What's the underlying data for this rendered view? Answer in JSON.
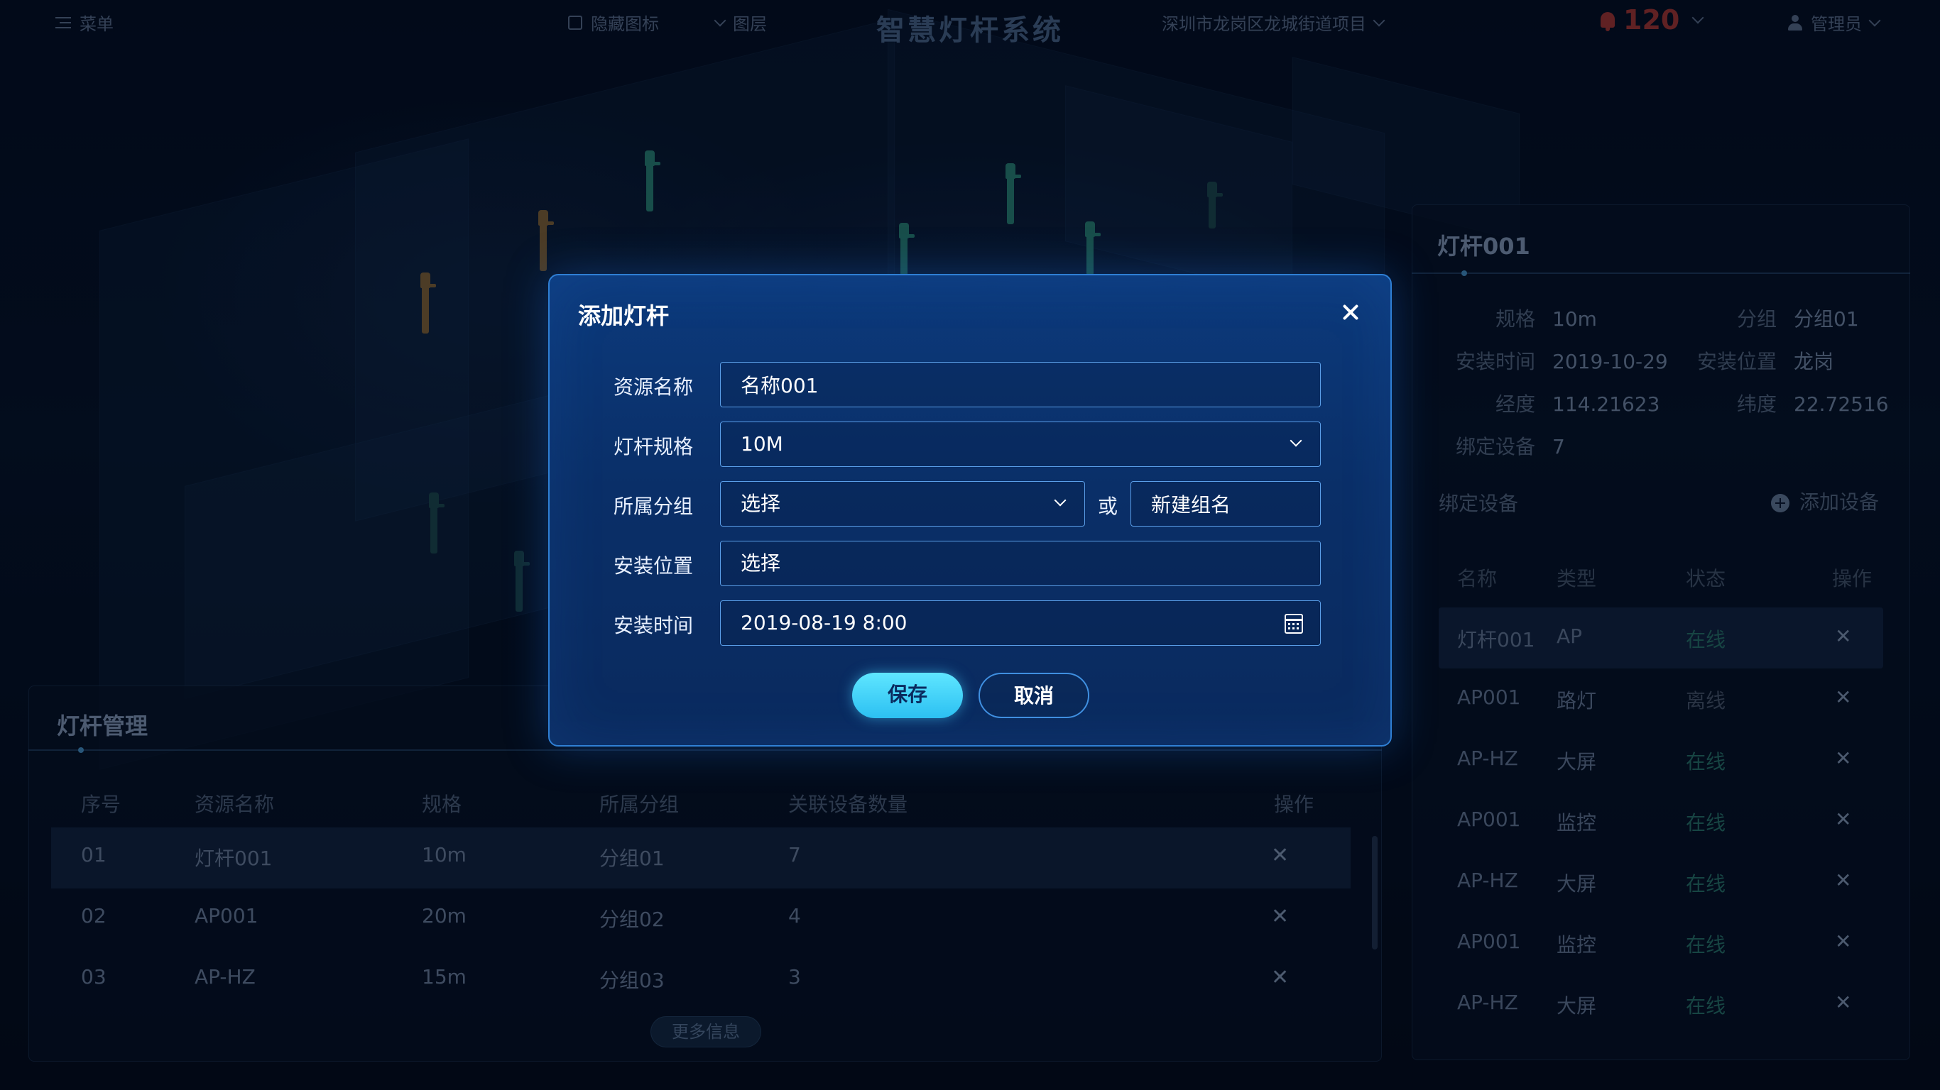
{
  "header": {
    "menu_label": "菜单",
    "hide_icons_label": "隐藏图标",
    "layers_label": "图层",
    "app_title": "智慧灯杆系统",
    "project": "深圳市龙岗区龙城街道项目",
    "alert_count": "120",
    "user": "管理员"
  },
  "left_panel": {
    "title": "灯杆管理",
    "columns": [
      "序号",
      "资源名称",
      "规格",
      "所属分组",
      "关联设备数量",
      "操作"
    ],
    "rows": [
      {
        "no": "01",
        "name": "灯杆001",
        "spec": "10m",
        "group": "分组01",
        "count": "7",
        "action": "✕"
      },
      {
        "no": "02",
        "name": "AP001",
        "spec": "20m",
        "group": "分组02",
        "count": "4",
        "action": "✕"
      },
      {
        "no": "03",
        "name": "AP-HZ",
        "spec": "15m",
        "group": "分组03",
        "count": "3",
        "action": "✕"
      }
    ],
    "more_label": "更多信息"
  },
  "right_panel": {
    "title": "灯杆001",
    "spec_label": "规格",
    "spec_value": "10m",
    "group_label": "分组",
    "group_value": "分组01",
    "install_time_label": "安装时间",
    "install_time_value": "2019-10-29",
    "install_loc_label": "安装位置",
    "install_loc_value": "龙岗",
    "lng_label": "经度",
    "lng_value": "114.21623",
    "lat_label": "纬度",
    "lat_value": "22.72516",
    "bound_label": "绑定设备",
    "bound_value": "7",
    "bound_section": "绑定设备",
    "add_device_label": "添加设备",
    "columns": [
      "名称",
      "类型",
      "状态",
      "操作"
    ],
    "rows": [
      {
        "name": "灯杆001",
        "type": "AP",
        "status": "在线",
        "action": "✕"
      },
      {
        "name": "AP001",
        "type": "路灯",
        "status": "离线",
        "action": "✕"
      },
      {
        "name": "AP-HZ",
        "type": "大屏",
        "status": "在线",
        "action": "✕"
      },
      {
        "name": "AP001",
        "type": "监控",
        "status": "在线",
        "action": "✕"
      },
      {
        "name": "AP-HZ",
        "type": "大屏",
        "status": "在线",
        "action": "✕"
      },
      {
        "name": "AP001",
        "type": "监控",
        "status": "在线",
        "action": "✕"
      },
      {
        "name": "AP-HZ",
        "type": "大屏",
        "status": "在线",
        "action": "✕"
      }
    ]
  },
  "modal": {
    "title": "添加灯杆",
    "name_label": "资源名称",
    "name_value": "名称001",
    "spec_label": "灯杆规格",
    "spec_value": "10M",
    "group_label": "所属分组",
    "group_value": "选择",
    "or_label": "或",
    "new_group_value": "新建组名",
    "location_label": "安装位置",
    "location_value": "选择",
    "time_label": "安装时间",
    "time_value": "2019-08-19 8:00",
    "save_label": "保存",
    "cancel_label": "取消"
  },
  "colors": {
    "accent": "#2cc0f2",
    "modal_bg": "#0c3a7c",
    "online": "#2a7a6e",
    "alert": "#b03a34"
  }
}
